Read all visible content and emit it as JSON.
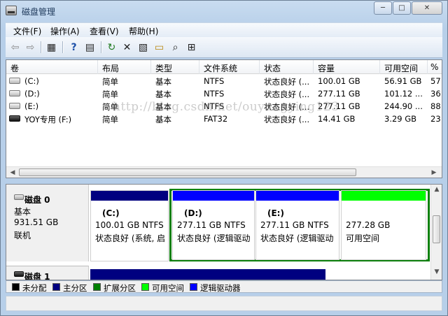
{
  "window": {
    "title": "磁盘管理",
    "min_glyph": "─",
    "max_glyph": "□",
    "close_glyph": "✕"
  },
  "menu": [
    "文件(F)",
    "操作(A)",
    "查看(V)",
    "帮助(H)"
  ],
  "toolbar": {
    "icons": [
      "back-icon",
      "forward-icon",
      "console-tree-icon",
      "help-icon",
      "show-hide-icon",
      "refresh-icon",
      "delete-icon",
      "properties-icon",
      "open-icon",
      "find-icon",
      "rescan-icon"
    ],
    "glyphs": {
      "back": "⇦",
      "forward": "⇨",
      "tree": "▦",
      "help": "?",
      "pane": "▤",
      "refresh": "↻",
      "delete": "✕",
      "properties": "▧",
      "open": "▭",
      "find": "⌕",
      "rescan": "⊞"
    }
  },
  "volume_table": {
    "columns": [
      "卷",
      "布局",
      "类型",
      "文件系统",
      "状态",
      "容量",
      "可用空间",
      "%"
    ],
    "rows": [
      {
        "volume": "(C:)",
        "layout": "简单",
        "type": "基本",
        "fs": "NTFS",
        "status": "状态良好 (...",
        "capacity": "100.01 GB",
        "free": "56.91 GB",
        "pct": "57"
      },
      {
        "volume": "(D:)",
        "layout": "简单",
        "type": "基本",
        "fs": "NTFS",
        "status": "状态良好 (...",
        "capacity": "277.11 GB",
        "free": "101.12 ...",
        "pct": "36"
      },
      {
        "volume": "(E:)",
        "layout": "简单",
        "type": "基本",
        "fs": "NTFS",
        "status": "状态良好 (...",
        "capacity": "277.11 GB",
        "free": "244.90 ...",
        "pct": "88"
      },
      {
        "volume": "YOY专用 (F:)",
        "layout": "简单",
        "type": "基本",
        "fs": "FAT32",
        "status": "状态良好 (...",
        "capacity": "14.41 GB",
        "free": "3.29 GB",
        "pct": "23"
      }
    ]
  },
  "watermark": "http://blog.csdn.net/ouyangying123",
  "disk0": {
    "name": "磁盘 0",
    "type": "基本",
    "size": "931.51 GB",
    "state": "联机",
    "partitions": [
      {
        "label": "(C:)",
        "size": "100.01 GB NTFS",
        "status": "状态良好 (系统, 启",
        "bar_color": "#000080"
      },
      {
        "label": "(D:)",
        "size": "277.11 GB NTFS",
        "status": "状态良好 (逻辑驱动",
        "bar_color": "#0000ff"
      },
      {
        "label": "(E:)",
        "size": "277.11 GB NTFS",
        "status": "状态良好 (逻辑驱动",
        "bar_color": "#0000ff"
      },
      {
        "label": "",
        "size": "277.28 GB",
        "status": "可用空间",
        "bar_color": "#00ff00"
      }
    ]
  },
  "disk1": {
    "name": "磁盘 1"
  },
  "legend": [
    {
      "label": "未分配",
      "color": "#000000"
    },
    {
      "label": "主分区",
      "color": "#000080"
    },
    {
      "label": "扩展分区",
      "color": "#008000"
    },
    {
      "label": "可用空间",
      "color": "#00ff00"
    },
    {
      "label": "逻辑驱动器",
      "color": "#0000ff"
    }
  ],
  "colors": {
    "extended_border": "#0c800c",
    "disk1_bar": "#000080"
  }
}
